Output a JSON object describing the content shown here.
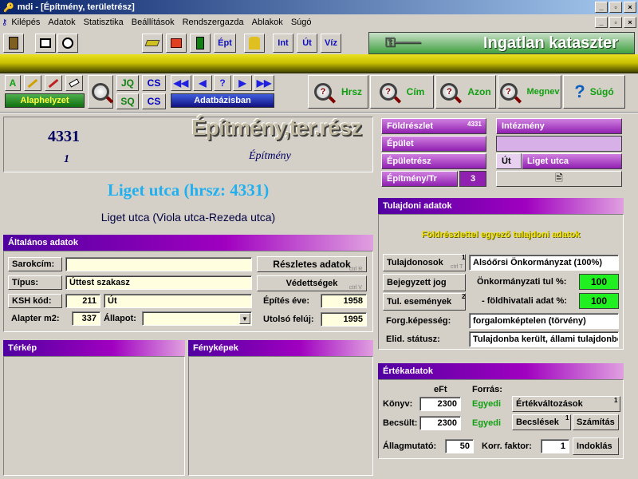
{
  "window": {
    "title": "mdi - [Építmény, területrész]",
    "min": "_",
    "max": "▫",
    "close": "×"
  },
  "menu": [
    "Kilépés",
    "Adatok",
    "Statisztika",
    "Beállítások",
    "Rendszergazda",
    "Ablakok",
    "Súgó"
  ],
  "toolbar": {
    "ept": "Épt",
    "int": "Int",
    "ut": "Út",
    "viz": "Víz",
    "banner": "Ingatlan kataszter"
  },
  "nav": {
    "alaphelyzet": "Alaphelyzet",
    "adatbazisban": "Adatbázisban",
    "a_btn": "A",
    "cs1": "CS",
    "cs2": "CS",
    "sq": "SQ",
    "jq": "JQ",
    "prev_all": "◀◀",
    "prev": "◀",
    "help": "?",
    "next": "▶",
    "next_all": "▶▶"
  },
  "search": {
    "hrsz": "Hrsz",
    "cim": "Cím",
    "azon": "Azon",
    "megnev": "Megnev",
    "sugo": "Súgó"
  },
  "header": {
    "number": "4331",
    "sub_number": "1",
    "type": "Építmény",
    "logo": "Építmény,ter.rész",
    "address_title": "Liget utca (hrsz: 4331)",
    "address_sub": "Liget utca (Viola utca-Rezeda utca)"
  },
  "hierarchy": {
    "foldreszlet": "Földrészlet",
    "foldreszlet_num": "4331",
    "epulet": "Épület",
    "epuletresz": "Épületrész",
    "epitmeny": "Építmény/Tr",
    "epitmeny_num": "3",
    "intezmeny": "Intézmény",
    "ut_label": "Út",
    "ut_value": "Liget utca"
  },
  "general": {
    "title": "Általános adatok",
    "sarokcim_label": "Sarokcím:",
    "sarokcim": "",
    "tipus_label": "Típus:",
    "tipus": "Úttest szakasz",
    "ksh_label": "KSH kód:",
    "ksh_code": "211",
    "ksh_name": "Út",
    "alapter_label": "Alapter m2:",
    "alapter": "337",
    "allapot_label": "Állapot:",
    "allapot": "",
    "reszletes": "Részletes adatok",
    "vedettsegek": "Védettségek",
    "epites_label": "Építés éve:",
    "epites": "1958",
    "utolso_label": "Utolsó felúj:",
    "utolso": "1995",
    "hk1": "ctrl R",
    "hk2": "ctrl V"
  },
  "terkep": "Térkép",
  "fenykepek": "Fényképek",
  "ownership": {
    "title": "Tulajdoni adatok",
    "notice": "Földrészlettel egyező tulajdoni adatok",
    "tulajdonosok": "Tulajdonosok",
    "owner": "Alsóőrsi Önkormányzat (100%)",
    "bejegyzett": "Bejegyzett jog",
    "onkorm_label": "Önkormányzati tul %:",
    "onkorm": "100",
    "tul_esemenyek": "Tul. események",
    "fold_label": "- földhivatali adat %:",
    "fold": "100",
    "forg_label": "Forg.képesség:",
    "forg": "forgalomképtelen (törvény)",
    "elid_label": "Elid. státusz:",
    "elid": "Tulajdonba került, állami tulajdonból",
    "hk1": "ctrl T",
    "sup1": "1",
    "sup2": "2"
  },
  "values": {
    "title": "Értékadatok",
    "eft": "eFt",
    "forras": "Forrás:",
    "konyv_label": "Könyv:",
    "konyv": "2300",
    "konyv_src": "Egyedi",
    "becsult_label": "Becsült:",
    "becsult": "2300",
    "becsult_src": "Egyedi",
    "ertekvalt": "Értékváltozások",
    "becslesek": "Becslések",
    "szamitas": "Számítás",
    "allag_label": "Állagmutató:",
    "allag": "50",
    "korr_label": "Korr. faktor:",
    "korr": "1",
    "indoklas": "Indoklás",
    "sup1": "1",
    "sup2": "1"
  }
}
